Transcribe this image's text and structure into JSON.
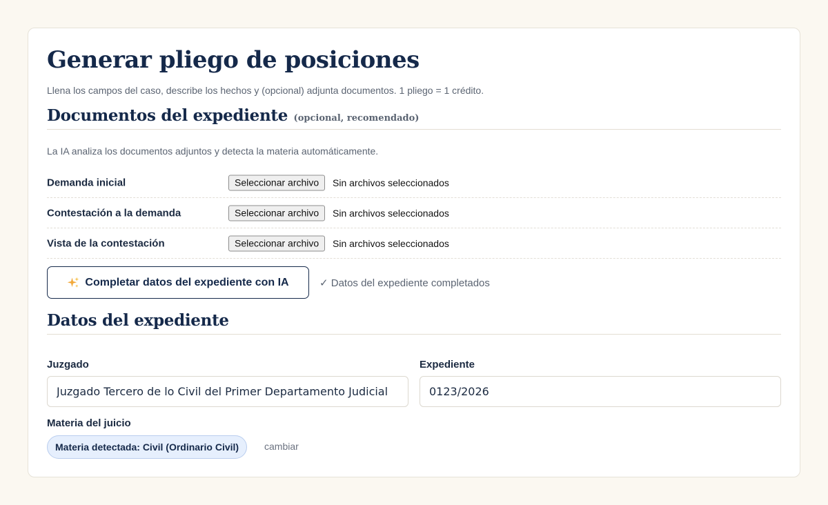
{
  "page": {
    "title": "Generar pliego de posiciones",
    "subtitle": "Llena los campos del caso, describe los hechos y (opcional) adjunta documentos. 1 pliego = 1 crédito."
  },
  "documents_section": {
    "title": "Documentos del expediente",
    "note": "(opcional, recomendado)",
    "helper": "La IA analiza los documentos adjuntos y detecta la materia automáticamente.",
    "rows": [
      {
        "label": "Demanda inicial",
        "button": "Seleccionar archivo",
        "status": "Sin archivos seleccionados"
      },
      {
        "label": "Contestación a la demanda",
        "button": "Seleccionar archivo",
        "status": "Sin archivos seleccionados"
      },
      {
        "label": "Vista de la contestación",
        "button": "Seleccionar archivo",
        "status": "Sin archivos seleccionados"
      }
    ],
    "ai_button_label": "Completar datos del expediente con IA",
    "ai_button_icon": "sparkles-icon",
    "ai_status": "✓ Datos del expediente completados"
  },
  "case_section": {
    "title": "Datos del expediente",
    "court_label": "Juzgado",
    "court_value": "Juzgado Tercero de lo Civil del Primer Departamento Judicial",
    "case_number_label": "Expediente",
    "case_number_value": "0123/2026",
    "subject_label": "Materia del juicio",
    "subject_pill": "Materia detectada: Civil (Ordinario Civil)",
    "change_link": "cambiar"
  },
  "colors": {
    "background": "#fbf8f1",
    "heading": "#15294a",
    "muted": "#5b6472",
    "pill_bg": "#e6effd",
    "pill_border": "#b9cdee",
    "sparkle": "#f2a93b"
  }
}
